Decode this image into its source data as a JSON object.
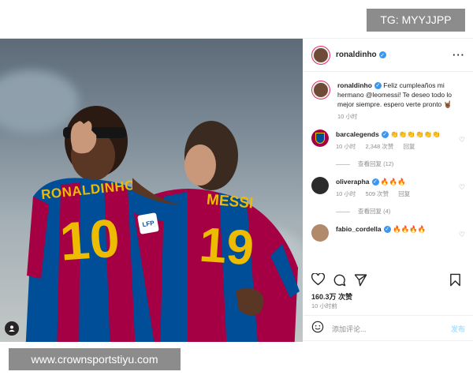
{
  "watermarks": {
    "top": "TG: MYYJJPP",
    "bottom": "www.crownsportstiyu.com"
  },
  "photo": {
    "left_jersey_name": "RONALDINHO",
    "left_jersey_number": "10",
    "right_jersey_name": "MESSI",
    "right_jersey_number": "19",
    "sponsor_badge": "LFP",
    "user_tag_icon": "user-icon"
  },
  "post": {
    "username": "ronaldinho",
    "more_icon": "···",
    "caption_user": "ronaldinho",
    "caption_text": "Feliz cumpleaños mi hermano @leomessi! Te deseo todo lo mejor siempre. espero verte pronto 🤘🏾",
    "caption_time": "10 小时"
  },
  "comments": [
    {
      "user": "barcalegends",
      "text": "👏👏👏👏👏👏",
      "time": "10 小时",
      "likes": "2,348 次赞",
      "reply": "回复",
      "view_replies": "查看回复 (12)"
    },
    {
      "user": "oliverapha",
      "text": "🔥🔥🔥",
      "time": "10 小时",
      "likes": "509 次赞",
      "reply": "回复",
      "view_replies": "查看回复 (4)"
    },
    {
      "user": "fabio_cordella",
      "text": "🔥🔥🔥🔥",
      "time": "",
      "likes": "",
      "reply": "",
      "view_replies": ""
    }
  ],
  "footer": {
    "like_count": "160.3万 次赞",
    "time": "10 小时前",
    "comment_placeholder": "添加评论...",
    "post_label": "发布"
  },
  "colors": {
    "verified": "#3897f0",
    "barca_red": "#a50044",
    "barca_blue": "#004d98",
    "gold": "#edbb00"
  }
}
